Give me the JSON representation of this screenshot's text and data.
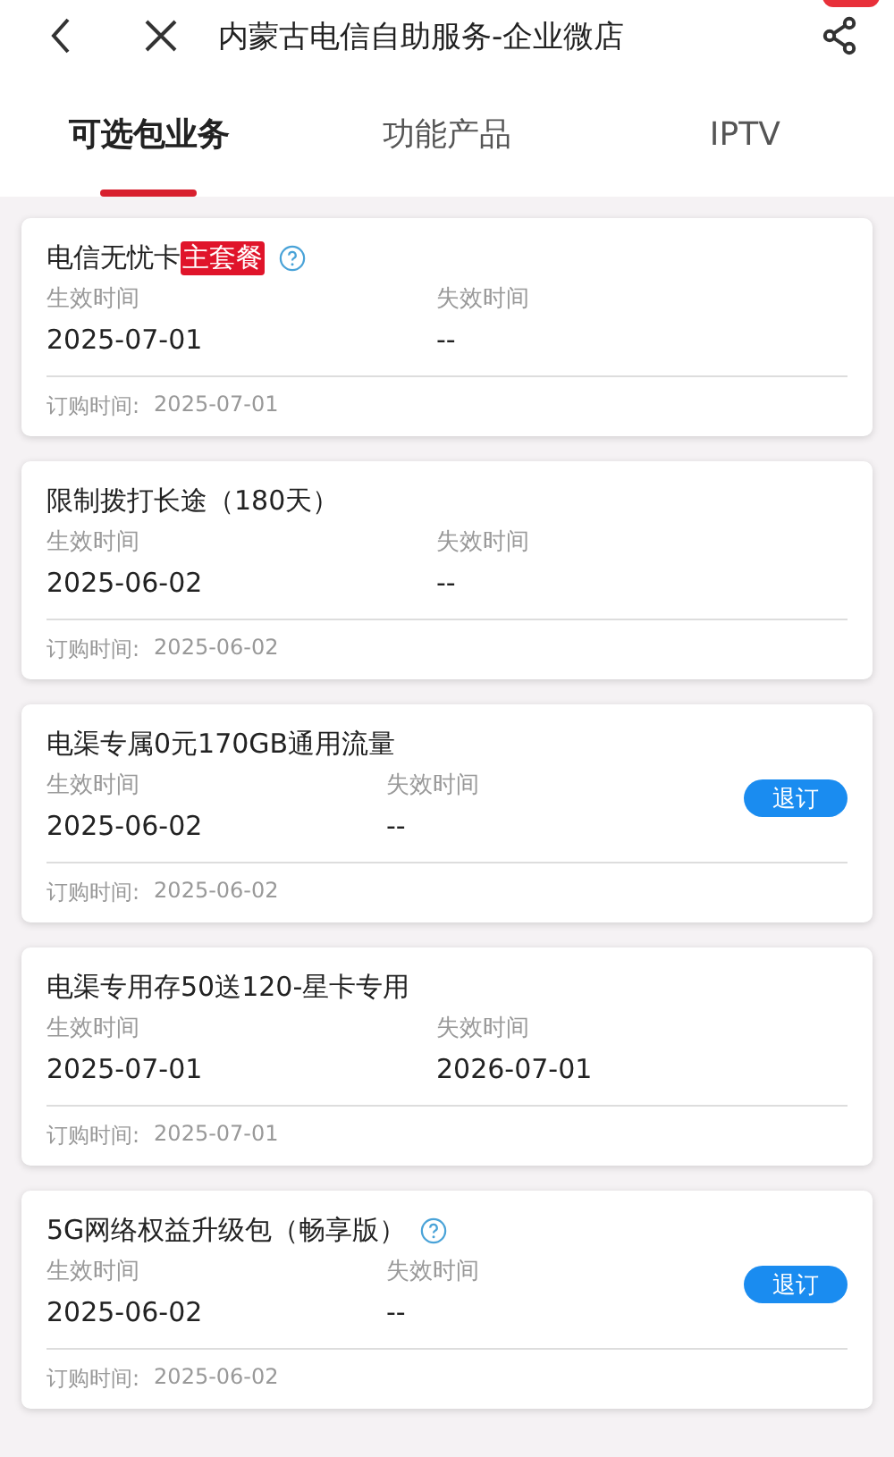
{
  "header": {
    "title": "内蒙古电信自助服务-企业微店"
  },
  "tabs": [
    {
      "label": "可选包业务",
      "selected": true
    },
    {
      "label": "功能产品",
      "selected": false
    },
    {
      "label": "IPTV",
      "selected": false
    }
  ],
  "packages": [
    {
      "name": "电信无忧卡",
      "badge": "主套餐",
      "help": true,
      "start_label": "生效时间",
      "start": "2025-07-01",
      "end_label": "失效时间",
      "end": "--",
      "order_label": "订购时间:",
      "order_date": "2025-07-01"
    },
    {
      "name": "限制拨打长途（180天）",
      "help": false,
      "start_label": "生效时间",
      "start": "2025-06-02",
      "end_label": "失效时间",
      "end": "--",
      "order_label": "订购时间:",
      "order_date": "2025-06-02"
    },
    {
      "name": "电渠专属0元170GB通用流量",
      "help": false,
      "start_label": "生效时间",
      "start": "2025-06-02",
      "end_label": "失效时间",
      "end": "--",
      "order_label": "订购时间:",
      "order_date": "2025-06-02",
      "action": "退订"
    },
    {
      "name": "电渠专用存50送120-星卡专用",
      "help": false,
      "start_label": "生效时间",
      "start": "2025-07-01",
      "end_label": "失效时间",
      "end": "2026-07-01",
      "order_label": "订购时间:",
      "order_date": "2025-07-01"
    },
    {
      "name": "5G网络权益升级包（畅享版）",
      "help": true,
      "start_label": "生效时间",
      "start": "2025-06-02",
      "end_label": "失效时间",
      "end": "--",
      "order_label": "订购时间:",
      "order_date": "2025-06-02",
      "action": "退订"
    }
  ]
}
